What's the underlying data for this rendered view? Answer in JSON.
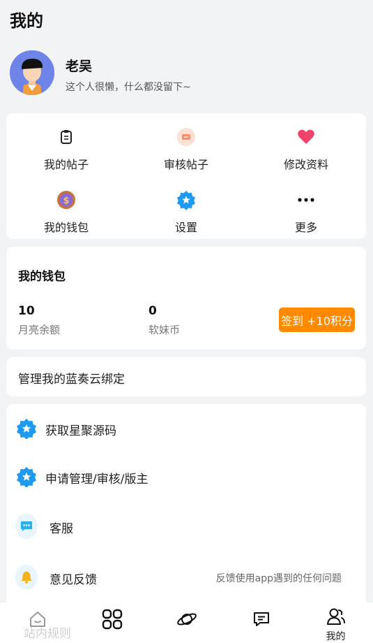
{
  "header": {
    "title": "我的"
  },
  "profile": {
    "name": "老吴",
    "bio": "这个人很懒，什么都没留下~"
  },
  "menu": {
    "items": [
      {
        "label": "我的帖子",
        "icon": "clipboard-icon"
      },
      {
        "label": "审核帖子",
        "icon": "review-icon"
      },
      {
        "label": "修改资料",
        "icon": "heart-icon"
      },
      {
        "label": "我的钱包",
        "icon": "coin-icon"
      },
      {
        "label": "设置",
        "icon": "star-badge-icon"
      },
      {
        "label": "更多",
        "icon": "more-icon"
      }
    ]
  },
  "wallet": {
    "title": "我的钱包",
    "balance_value": "10",
    "balance_label": "月亮余额",
    "coin_value": "0",
    "coin_label": "软妹币",
    "checkin_label": "签到 +10积分"
  },
  "lanzou": {
    "label": "管理我的蓝奏云绑定"
  },
  "list": {
    "rows": [
      {
        "label": "获取星聚源码",
        "icon": "star-badge-icon",
        "hint": ""
      },
      {
        "label": "申请管理/审核/版主",
        "icon": "star-badge-icon",
        "hint": ""
      },
      {
        "label": "客服",
        "icon": "chat-icon",
        "hint": ""
      },
      {
        "label": "意见反馈",
        "icon": "bell-icon",
        "hint": "反馈使用app遇到的任何问题"
      }
    ]
  },
  "tabbar": {
    "ghost_label": "站内规则",
    "tabs": [
      {
        "label": "",
        "icon": "home-icon"
      },
      {
        "label": "",
        "icon": "apps-icon"
      },
      {
        "label": "",
        "icon": "planet-icon"
      },
      {
        "label": "",
        "icon": "message-icon"
      },
      {
        "label": "我的",
        "icon": "user-icon"
      }
    ]
  },
  "colors": {
    "accent": "#ff8a00",
    "badge_blue": "#1e9bf0",
    "heart": "#f0436a",
    "page_bg": "#f2f3f5"
  }
}
